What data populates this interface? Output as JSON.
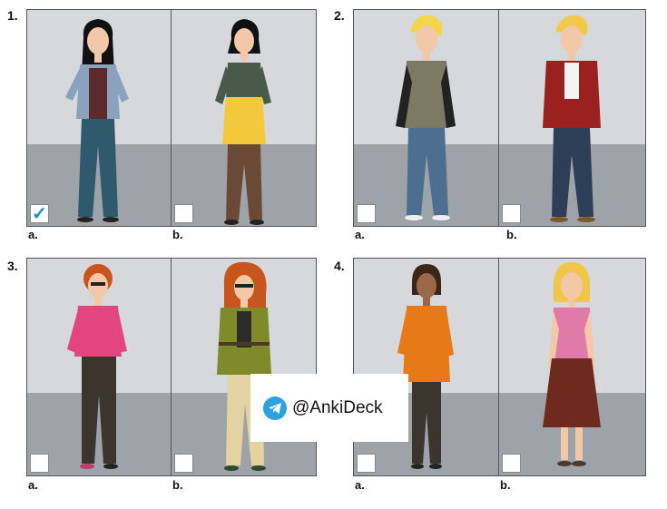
{
  "questions": [
    {
      "number": "1.",
      "options": [
        {
          "label": "a.",
          "checked": true
        },
        {
          "label": "b.",
          "checked": false
        }
      ]
    },
    {
      "number": "2.",
      "options": [
        {
          "label": "a.",
          "checked": false
        },
        {
          "label": "b.",
          "checked": false
        }
      ]
    },
    {
      "number": "3.",
      "options": [
        {
          "label": "a.",
          "checked": false
        },
        {
          "label": "b.",
          "checked": false
        }
      ]
    },
    {
      "number": "4.",
      "options": [
        {
          "label": "a.",
          "checked": false
        },
        {
          "label": "b.",
          "checked": false
        }
      ]
    }
  ],
  "check_mark": "✓",
  "watermark": {
    "text": "@AnkiDeck",
    "icon": "telegram-icon"
  },
  "colors": {
    "wall": "#d6d8db",
    "floor": "#9ea3a9",
    "check": "#1a8fd6",
    "telegram": "#2aa3df"
  }
}
